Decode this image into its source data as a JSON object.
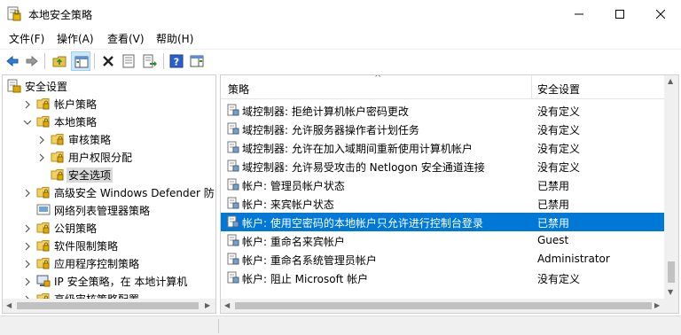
{
  "window": {
    "title": "本地安全策略"
  },
  "menu": [
    "文件(F)",
    "操作(A)",
    "查看(V)",
    "帮助(H)"
  ],
  "toolbar": {
    "icons": [
      "back-arrow",
      "forward-arrow",
      "up-folder",
      "show-hide-tree",
      "delete",
      "properties",
      "export-list",
      "help",
      "show-action-pane"
    ]
  },
  "tree": {
    "items": [
      {
        "label": "安全设置",
        "level": 0,
        "expanded": true
      },
      {
        "label": "帐户策略",
        "level": 1,
        "expanded": false
      },
      {
        "label": "本地策略",
        "level": 1,
        "expanded": true
      },
      {
        "label": "审核策略",
        "level": 2,
        "expanded": false
      },
      {
        "label": "用户权限分配",
        "level": 2,
        "expanded": false
      },
      {
        "label": "安全选项",
        "level": 2,
        "selected": true
      },
      {
        "label": "高级安全 Windows Defender 防",
        "level": 1,
        "expanded": false
      },
      {
        "label": "网络列表管理器策略",
        "level": 1
      },
      {
        "label": "公钥策略",
        "level": 1,
        "expanded": false
      },
      {
        "label": "软件限制策略",
        "level": 1,
        "expanded": false
      },
      {
        "label": "应用程序控制策略",
        "level": 1,
        "expanded": false
      },
      {
        "label": "IP 安全策略，在 本地计算机",
        "level": 1,
        "expanded": false
      },
      {
        "label": "高级审核策略配置",
        "level": 1,
        "expanded": false
      }
    ]
  },
  "list": {
    "columns": [
      "策略",
      "安全设置"
    ],
    "rows": [
      {
        "policy": "域控制器: 拒绝计算机帐户密码更改",
        "setting": "没有定义"
      },
      {
        "policy": "域控制器: 允许服务器操作者计划任务",
        "setting": "没有定义"
      },
      {
        "policy": "域控制器:  允许在加入域期间重新使用计算机帐户",
        "setting": "没有定义"
      },
      {
        "policy": "域控制器:  允许易受攻击的 Netlogon 安全通道连接",
        "setting": "没有定义"
      },
      {
        "policy": "帐户: 管理员帐户状态",
        "setting": "已禁用"
      },
      {
        "policy": "帐户: 来宾帐户状态",
        "setting": "已禁用"
      },
      {
        "policy": "帐户: 使用空密码的本地帐户只允许进行控制台登录",
        "setting": "已禁用",
        "selected": true
      },
      {
        "policy": "帐户: 重命名来宾帐户",
        "setting": "Guest"
      },
      {
        "policy": "帐户: 重命名系统管理员帐户",
        "setting": "Administrator"
      },
      {
        "policy": "帐户: 阻止 Microsoft 帐户",
        "setting": "没有定义"
      }
    ]
  },
  "colors": {
    "selection": "#0078d7",
    "tree_selection": "#d9d9d9"
  }
}
